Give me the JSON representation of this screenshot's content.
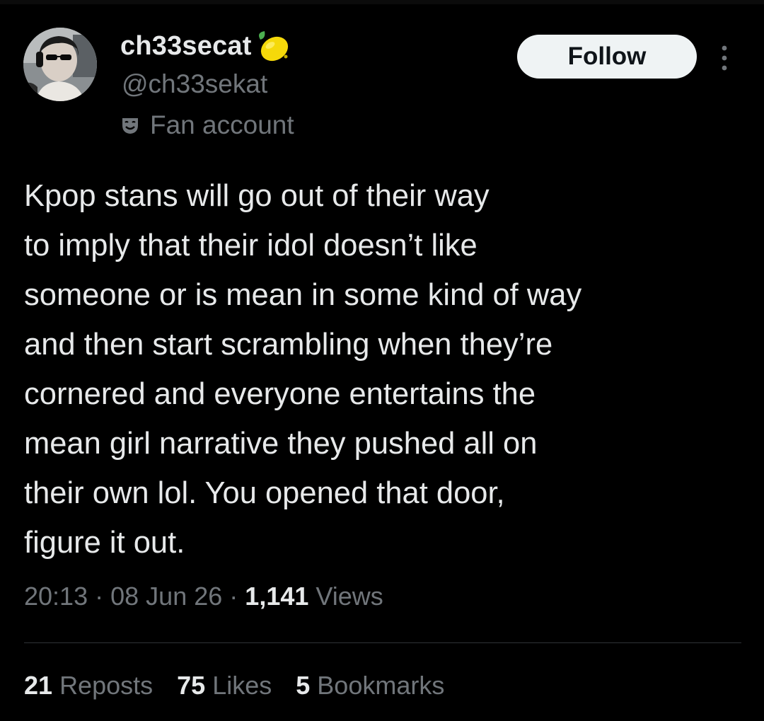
{
  "user": {
    "display_name": "ch33secat",
    "handle": "@ch33sekat",
    "label": "Fan account",
    "emoji_icon": "lemon-icon",
    "label_icon": "mask-icon"
  },
  "follow_button": {
    "label": "Follow"
  },
  "more_menu_icon": "vertical-ellipsis-icon",
  "tweet": {
    "text": "Kpop stans will go out of their way\nto imply that their idol doesn’t like\nsomeone or is mean in some kind of way\nand then start scrambling when they’re\ncornered and everyone entertains the\nmean girl narrative they pushed all on\ntheir own lol. You opened that door,\nfigure it out."
  },
  "meta": {
    "time": "20:13",
    "date": "08 Jun 26",
    "views_count": "1,141",
    "views_label": "Views",
    "separator": "·"
  },
  "stats": {
    "reposts_count": "21",
    "reposts_label": "Reposts",
    "likes_count": "75",
    "likes_label": "Likes",
    "bookmarks_count": "5",
    "bookmarks_label": "Bookmarks"
  },
  "colors": {
    "background": "#000000",
    "primary_text": "#e7e9ea",
    "secondary_text": "#71767b",
    "divider": "#2f3336",
    "follow_button_bg": "#eff3f4",
    "lemon": "#f5d90a"
  }
}
